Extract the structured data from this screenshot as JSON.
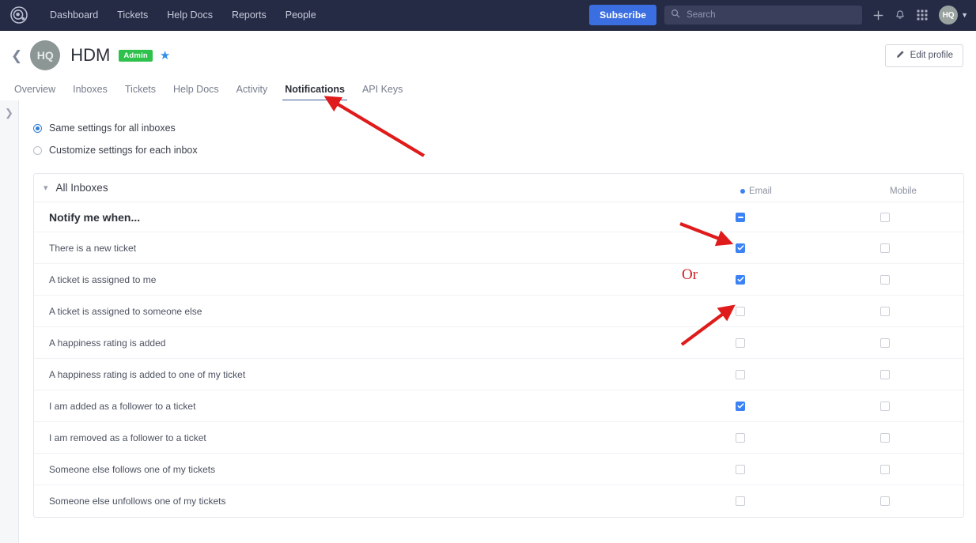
{
  "topnav": {
    "logo_icon": "target-logo-icon",
    "links": [
      {
        "label": "Dashboard"
      },
      {
        "label": "Tickets"
      },
      {
        "label": "Help Docs"
      },
      {
        "label": "Reports"
      },
      {
        "label": "People"
      }
    ],
    "subscribe_label": "Subscribe",
    "search": {
      "placeholder": "Search",
      "value": "",
      "icon": "search-icon"
    },
    "plus_icon": "plus-icon",
    "bell_icon": "bell-icon",
    "grid_icon": "app-grid-icon",
    "avatar_initials": "HQ",
    "caret_icon": "chevron-down-icon",
    "bg_color": "#252a45",
    "subscribe_color": "#3b6ee0"
  },
  "profile": {
    "back_icon": "chevron-left-icon",
    "avatar_initials": "HQ",
    "name": "HDM",
    "badge": "Admin",
    "badge_color": "#2ec14b",
    "star_icon": "star-icon",
    "star_color": "#2f8fe8",
    "edit_button": {
      "label": "Edit profile",
      "icon": "pencil-icon"
    },
    "tabs": [
      {
        "label": "Overview",
        "active": false
      },
      {
        "label": "Inboxes",
        "active": false
      },
      {
        "label": "Tickets",
        "active": false
      },
      {
        "label": "Help Docs",
        "active": false
      },
      {
        "label": "Activity",
        "active": false
      },
      {
        "label": "Notifications",
        "active": true
      },
      {
        "label": "API Keys",
        "active": false
      }
    ]
  },
  "left_rail": {
    "expand_icon": "chevron-right-icon"
  },
  "settings": {
    "scope_options": [
      {
        "label": "Same settings for all inboxes",
        "selected": true
      },
      {
        "label": "Customize settings for each inbox",
        "selected": false
      }
    ]
  },
  "card": {
    "collapse_icon": "chevron-down-icon",
    "title": "All Inboxes",
    "columns": [
      {
        "label": "Email",
        "has_dot": true,
        "dot_color": "#3b82f6"
      },
      {
        "label": "Mobile",
        "has_dot": false
      }
    ],
    "header_row": {
      "label": "Notify me when...",
      "email": "indeterminate",
      "mobile": "unchecked"
    },
    "rows": [
      {
        "label": "There is a new ticket",
        "email": "checked",
        "mobile": "unchecked"
      },
      {
        "label": "A ticket is assigned to me",
        "email": "checked",
        "mobile": "unchecked"
      },
      {
        "label": "A ticket is assigned to someone else",
        "email": "unchecked",
        "mobile": "unchecked"
      },
      {
        "label": "A happiness rating is added",
        "email": "unchecked",
        "mobile": "unchecked"
      },
      {
        "label": "A happiness rating is added to one of my ticket",
        "email": "unchecked",
        "mobile": "unchecked"
      },
      {
        "label": "I am added as a follower to a ticket",
        "email": "checked",
        "mobile": "unchecked"
      },
      {
        "label": "I am removed as a follower to a ticket",
        "email": "unchecked",
        "mobile": "unchecked"
      },
      {
        "label": "Someone else follows one of my tickets",
        "email": "unchecked",
        "mobile": "unchecked"
      },
      {
        "label": "Someone else unfollows one of my tickets",
        "email": "unchecked",
        "mobile": "unchecked"
      }
    ]
  },
  "annotations": {
    "or_label": "Or",
    "color": "#d32020",
    "arrows": [
      {
        "name": "arrow-to-notifications-tab"
      },
      {
        "name": "arrow-to-master-email-checkbox"
      },
      {
        "name": "arrow-to-assigned-to-me-email-checkbox"
      }
    ]
  }
}
